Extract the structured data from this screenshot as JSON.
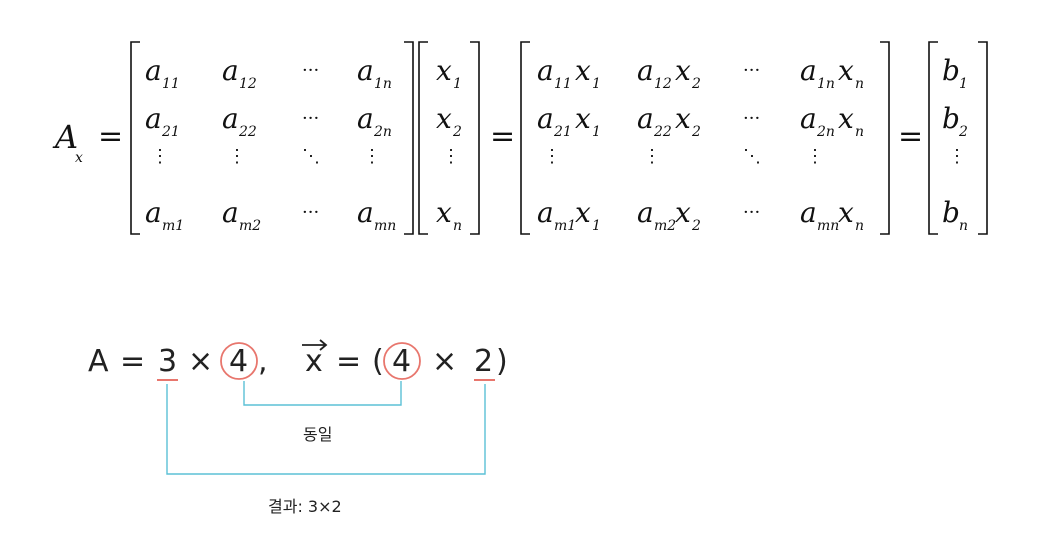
{
  "equation": {
    "lhs": {
      "base": "A",
      "sub": "x"
    },
    "equals": "=",
    "dots": {
      "h": "···",
      "v": "⋮",
      "d": "⋱"
    },
    "matrix_a": [
      [
        {
          "b": "a",
          "s": "11"
        },
        {
          "b": "a",
          "s": "12"
        },
        {
          "b": "···",
          "s": ""
        },
        {
          "b": "a",
          "s": "1n"
        }
      ],
      [
        {
          "b": "a",
          "s": "21"
        },
        {
          "b": "a",
          "s": "22"
        },
        {
          "b": "···",
          "s": ""
        },
        {
          "b": "a",
          "s": "2n"
        }
      ],
      [
        {
          "b": "⋮",
          "s": ""
        },
        {
          "b": "⋮",
          "s": ""
        },
        {
          "b": "⋱",
          "s": ""
        },
        {
          "b": "⋮",
          "s": ""
        }
      ],
      [
        {
          "b": "a",
          "s": "m1"
        },
        {
          "b": "a",
          "s": "m2"
        },
        {
          "b": "···",
          "s": ""
        },
        {
          "b": "a",
          "s": "mn"
        }
      ]
    ],
    "vector_x": [
      {
        "b": "x",
        "s": "1"
      },
      {
        "b": "x",
        "s": "2"
      },
      {
        "b": "⋮",
        "s": ""
      },
      {
        "b": "x",
        "s": "n"
      }
    ],
    "product": [
      [
        {
          "a": "11",
          "x": "1"
        },
        {
          "a": "12",
          "x": "2"
        },
        {
          "dots": "···"
        },
        {
          "a": "1n",
          "x": "n"
        }
      ],
      [
        {
          "a": "21",
          "x": "1"
        },
        {
          "a": "22",
          "x": "2"
        },
        {
          "dots": "···"
        },
        {
          "a": "2n",
          "x": "n"
        }
      ],
      [
        {
          "dots": "⋮"
        },
        {
          "dots": "⋮"
        },
        {
          "dots": "⋱"
        },
        {
          "dots": "⋮"
        }
      ],
      [
        {
          "a": "m1",
          "x": "1"
        },
        {
          "a": "m2",
          "x": "2"
        },
        {
          "dots": "···"
        },
        {
          "a": "mn",
          "x": "n"
        }
      ]
    ],
    "vector_b": [
      {
        "b": "b",
        "s": "1"
      },
      {
        "b": "b",
        "s": "2"
      },
      {
        "b": "⋮",
        "s": ""
      },
      {
        "b": "b",
        "s": "n"
      }
    ]
  },
  "handwriting": {
    "a_label": "A",
    "eq1": "=",
    "a_rows": "3",
    "times1": "×",
    "a_cols": "4",
    "comma": ",",
    "x_label": "x",
    "eq2": "=",
    "open_paren": "(",
    "x_rows": "4",
    "times2": "×",
    "x_cols": "2",
    "close_paren": ")",
    "same_label": "동일",
    "result_label": "결과: 3×2",
    "colors": {
      "circle": "#e8766d",
      "bracket": "#5bc0d6",
      "underline": "#e8766d",
      "ink": "#222222"
    }
  }
}
